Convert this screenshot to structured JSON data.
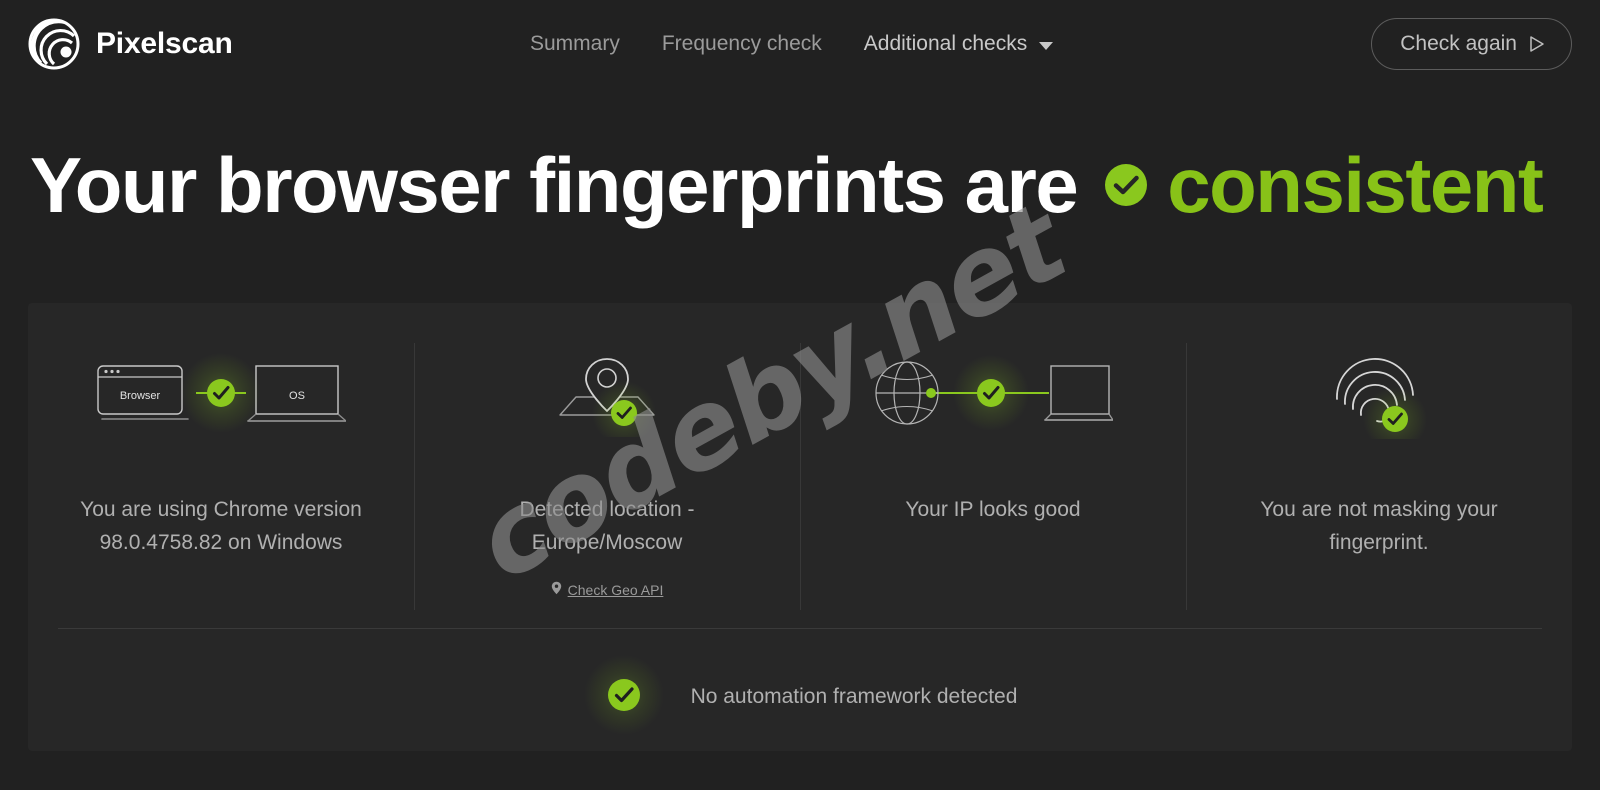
{
  "brand": {
    "name": "Pixelscan",
    "logo_icon": "pixelscan-spiral-logo"
  },
  "nav": {
    "items": [
      {
        "label": "Summary"
      },
      {
        "label": "Frequency check"
      },
      {
        "label": "Additional checks",
        "icon": "chevron-down-icon"
      }
    ]
  },
  "header": {
    "check_again_label": "Check again",
    "check_again_icon": "play-triangle-icon"
  },
  "headline": {
    "main": "Your browser fingerprints are",
    "status": "consistent",
    "status_icon": "check-circle-icon"
  },
  "cards": [
    {
      "icon": "browser-os-link-icon",
      "icon_labels": {
        "left": "Browser",
        "right": "OS"
      },
      "text": "You are using Chrome version 98.0.4758.82 on Windows"
    },
    {
      "icon": "map-pin-icon",
      "text": "Detected location - Europe/Moscow",
      "link": {
        "label": "Check Geo API",
        "icon": "map-pin-small-icon"
      }
    },
    {
      "icon": "globe-laptop-link-icon",
      "text": "Your IP looks good"
    },
    {
      "icon": "fingerprint-icon",
      "text": "You are not masking your fingerprint."
    }
  ],
  "bottom": {
    "icon": "check-circle-icon",
    "text": "No automation framework detected"
  },
  "watermark": {
    "text": "codeby.net"
  },
  "colors": {
    "page_background": "#212121",
    "panel_background": "#272727",
    "accent_green": "#88c218",
    "badge_green": "#8ac81e",
    "text_primary": "#ffffff",
    "text_secondary": "#b0b0b0",
    "divider": "#383838"
  }
}
